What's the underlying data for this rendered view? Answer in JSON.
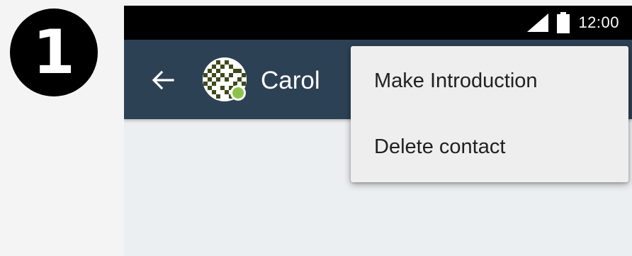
{
  "step": {
    "number": "1"
  },
  "status_bar": {
    "time": "12:00",
    "signal_icon": "cellular-signal-icon",
    "battery_icon": "battery-full-icon"
  },
  "app_bar": {
    "back_icon": "arrow-back-icon",
    "contact_name": "Carol",
    "avatar_status": "online",
    "colors": {
      "background": "#2d4155",
      "online": "#8bc34a"
    }
  },
  "menu": {
    "items": [
      {
        "label": "Make Introduction"
      },
      {
        "label": "Delete contact"
      }
    ]
  }
}
